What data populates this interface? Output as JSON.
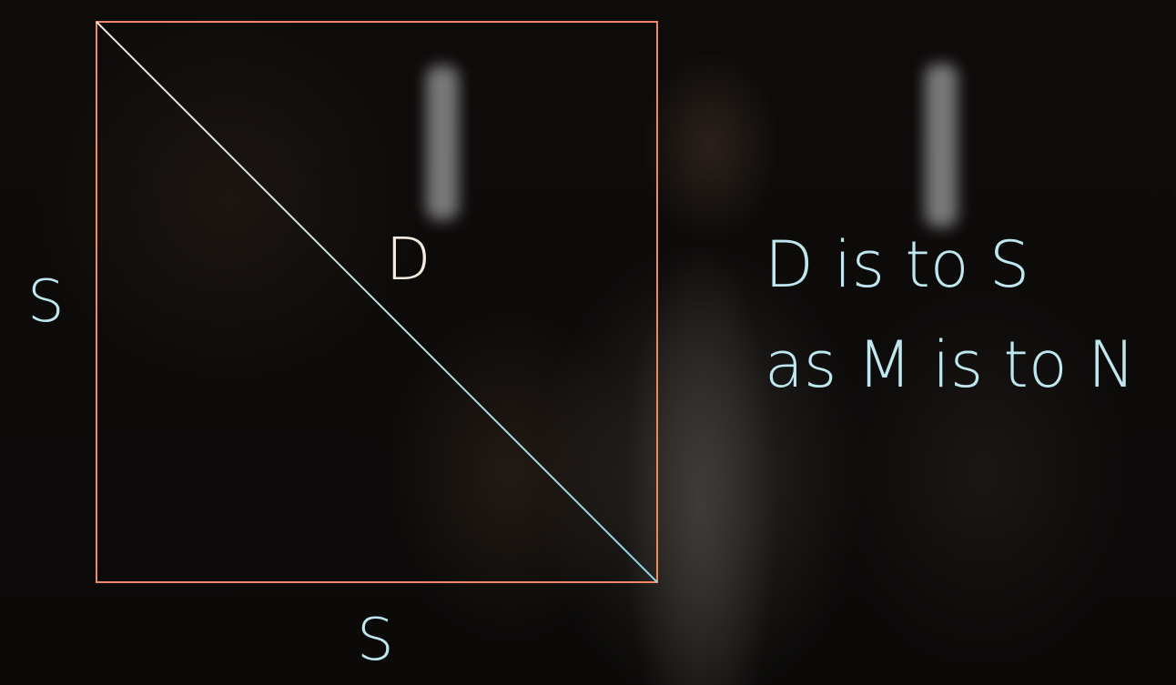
{
  "diagram": {
    "side_left_label": "S",
    "side_bottom_label": "S",
    "diagonal_label": "D",
    "colors": {
      "square_border": "#f08a5d",
      "diagonal_start": "#f4ecde",
      "diagonal_end": "#8fd6e6",
      "label_text": "#bfe7ef"
    }
  },
  "statement": {
    "line1": "D is to S",
    "line2": "as M is to N"
  }
}
